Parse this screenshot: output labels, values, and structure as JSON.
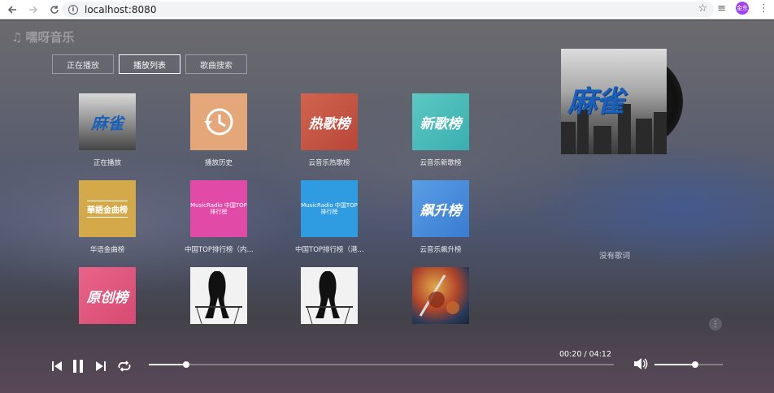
{
  "browser": {
    "url": "localhost:8080",
    "profile_initials": "金东"
  },
  "app": {
    "logo_text": "嘿呀音乐",
    "tabs": [
      {
        "label": "正在播放",
        "active": false
      },
      {
        "label": "播放列表",
        "active": true
      },
      {
        "label": "歌曲搜索",
        "active": false
      }
    ],
    "playlists": [
      {
        "label": "正在播放",
        "cover_text": "麻雀",
        "cover_style": "city"
      },
      {
        "label": "播放历史",
        "cover_text": "",
        "cover_style": "history"
      },
      {
        "label": "云音乐热歌榜",
        "cover_text": "热歌榜",
        "cover_style": "hot"
      },
      {
        "label": "云音乐新歌榜",
        "cover_text": "新歌榜",
        "cover_style": "new"
      },
      {
        "label": "华语金曲榜",
        "cover_text": "華語金曲榜",
        "cover_style": "gold"
      },
      {
        "label": "中国TOP排行榜（内...",
        "cover_text": "MusicRadio 中国TOP排行榜",
        "cover_style": "pink"
      },
      {
        "label": "中国TOP排行榜（港...",
        "cover_text": "MusicRadio 中国TOP排行榜",
        "cover_style": "blue"
      },
      {
        "label": "云音乐飙升榜",
        "cover_text": "飙升榜",
        "cover_style": "rise"
      },
      {
        "label": "",
        "cover_text": "原创榜",
        "cover_style": "original"
      },
      {
        "label": "",
        "cover_text": "",
        "cover_style": "sketch"
      },
      {
        "label": "",
        "cover_text": "",
        "cover_style": "sketch"
      },
      {
        "label": "",
        "cover_text": "",
        "cover_style": "painting"
      }
    ],
    "album_title": "麻雀",
    "lyrics_placeholder": "没有歌词"
  },
  "player": {
    "current_time": "00:20",
    "total_time": "04:12",
    "time_display": "00:20 / 04:12",
    "progress_percent": 8,
    "volume_percent": 60
  },
  "icons": {
    "logo": "music-note-icon",
    "prev": "skip-previous-icon",
    "pause": "pause-icon",
    "next": "skip-next-icon",
    "loop": "loop-icon",
    "volume": "volume-icon",
    "more": "more-vertical-icon"
  }
}
